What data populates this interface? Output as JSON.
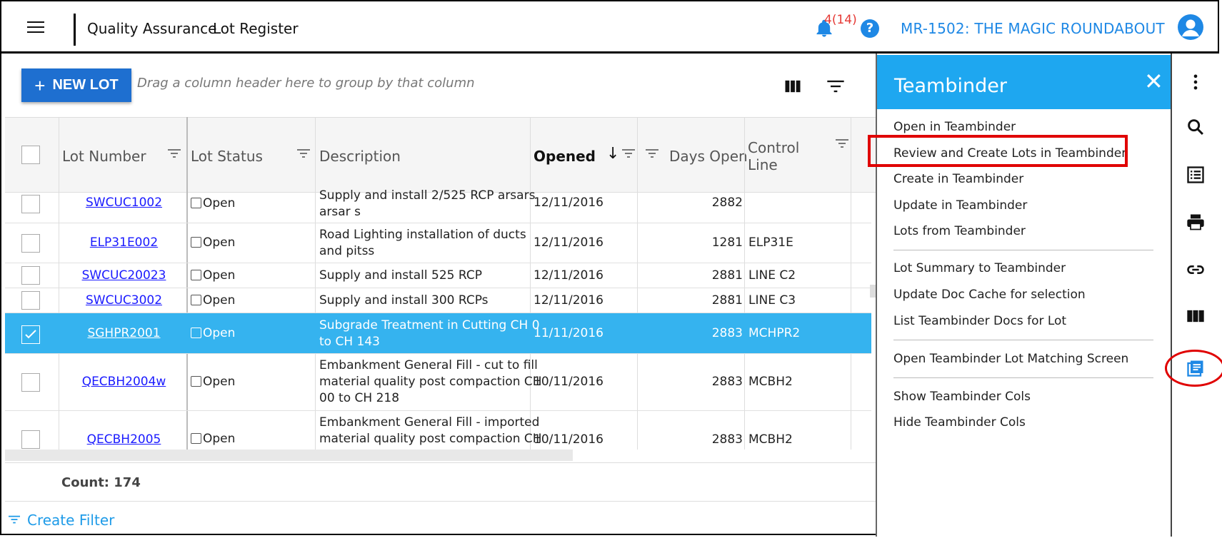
{
  "header": {
    "app_section": "Quality Assurance",
    "page": "Lot Register",
    "notification_count": "4(14)",
    "help_symbol": "?",
    "project": "MR-1502: THE MAGIC ROUNDABOUT"
  },
  "toolbar": {
    "new_lot_plus": "+",
    "new_lot_label": "NEW LOT",
    "group_hint": "Drag a column header here to group by that column"
  },
  "grid": {
    "columns": {
      "lot_number": "Lot Number",
      "lot_status": "Lot Status",
      "description": "Description",
      "opened": "Opened",
      "days_open": "Days Open",
      "control_line_1": "Control",
      "control_line_2": "Line"
    },
    "rows": [
      {
        "lot": "SWCUC1002",
        "status": "Open",
        "desc1": "Supply and install 2/525 RCP arsars",
        "desc2": "arsar s",
        "opened": "12/11/2016",
        "days": "2882",
        "control": "",
        "selected": false
      },
      {
        "lot": "ELP31E002",
        "status": "Open",
        "desc1": "Road Lighting installation of ducts",
        "desc2": "and pitss",
        "opened": "12/11/2016",
        "days": "1281",
        "control": "ELP31E",
        "selected": false
      },
      {
        "lot": "SWCUC20023",
        "status": "Open",
        "desc1": "Supply and install 525 RCP",
        "desc2": "",
        "opened": "12/11/2016",
        "days": "2881",
        "control": "LINE C2",
        "selected": false
      },
      {
        "lot": "SWCUC3002",
        "status": "Open",
        "desc1": "Supply and install 300 RCPs",
        "desc2": "",
        "opened": "12/11/2016",
        "days": "2881",
        "control": "LINE C3",
        "selected": false
      },
      {
        "lot": "SGHPR2001",
        "status": "Open",
        "desc1": "Subgrade Treatment in Cutting CH 0",
        "desc2": "to CH 143",
        "opened": "11/11/2016",
        "days": "2883",
        "control": "MCHPR2",
        "selected": true
      },
      {
        "lot": "QECBH2004w",
        "status": "Open",
        "desc1": "Embankment General Fill - cut to fill",
        "desc2": "material quality post compaction CH",
        "desc3": "00 to CH 218",
        "opened": "10/11/2016",
        "days": "2883",
        "control": "MCBH2",
        "selected": false
      },
      {
        "lot": "QECBH2005",
        "status": "Open",
        "desc1": "Embankment General Fill - imported",
        "desc2": "material quality post compaction CH",
        "opened": "10/11/2016",
        "days": "2883",
        "control": "MCBH2",
        "selected": false
      }
    ],
    "count_label": "Count: 174",
    "create_filter": "Create Filter"
  },
  "teambinder": {
    "title": "Teambinder",
    "close": "✕",
    "items": [
      "Open in Teambinder",
      "Review and Create Lots in Teambinder",
      "Create in Teambinder",
      "Update in Teambinder",
      "Lots from Teambinder",
      "Lot Summary to Teambinder",
      "Update Doc Cache for selection",
      "List Teambinder Docs for Lot",
      "Open Teambinder Lot Matching Screen",
      "Show Teambinder Cols",
      "Hide Teambinder Cols"
    ]
  },
  "colors": {
    "accent": "#1e88e5",
    "selected_row": "#35b3ef",
    "panel_header": "#1ea7f0",
    "highlight": "#e00000"
  },
  "icons": [
    "hamburger-icon",
    "bell-icon",
    "help-icon",
    "avatar-icon",
    "columns-icon",
    "filter-icon",
    "more-vert-icon",
    "search-icon",
    "list-icon",
    "print-icon",
    "link-icon",
    "columns-rail-icon",
    "library-icon"
  ]
}
